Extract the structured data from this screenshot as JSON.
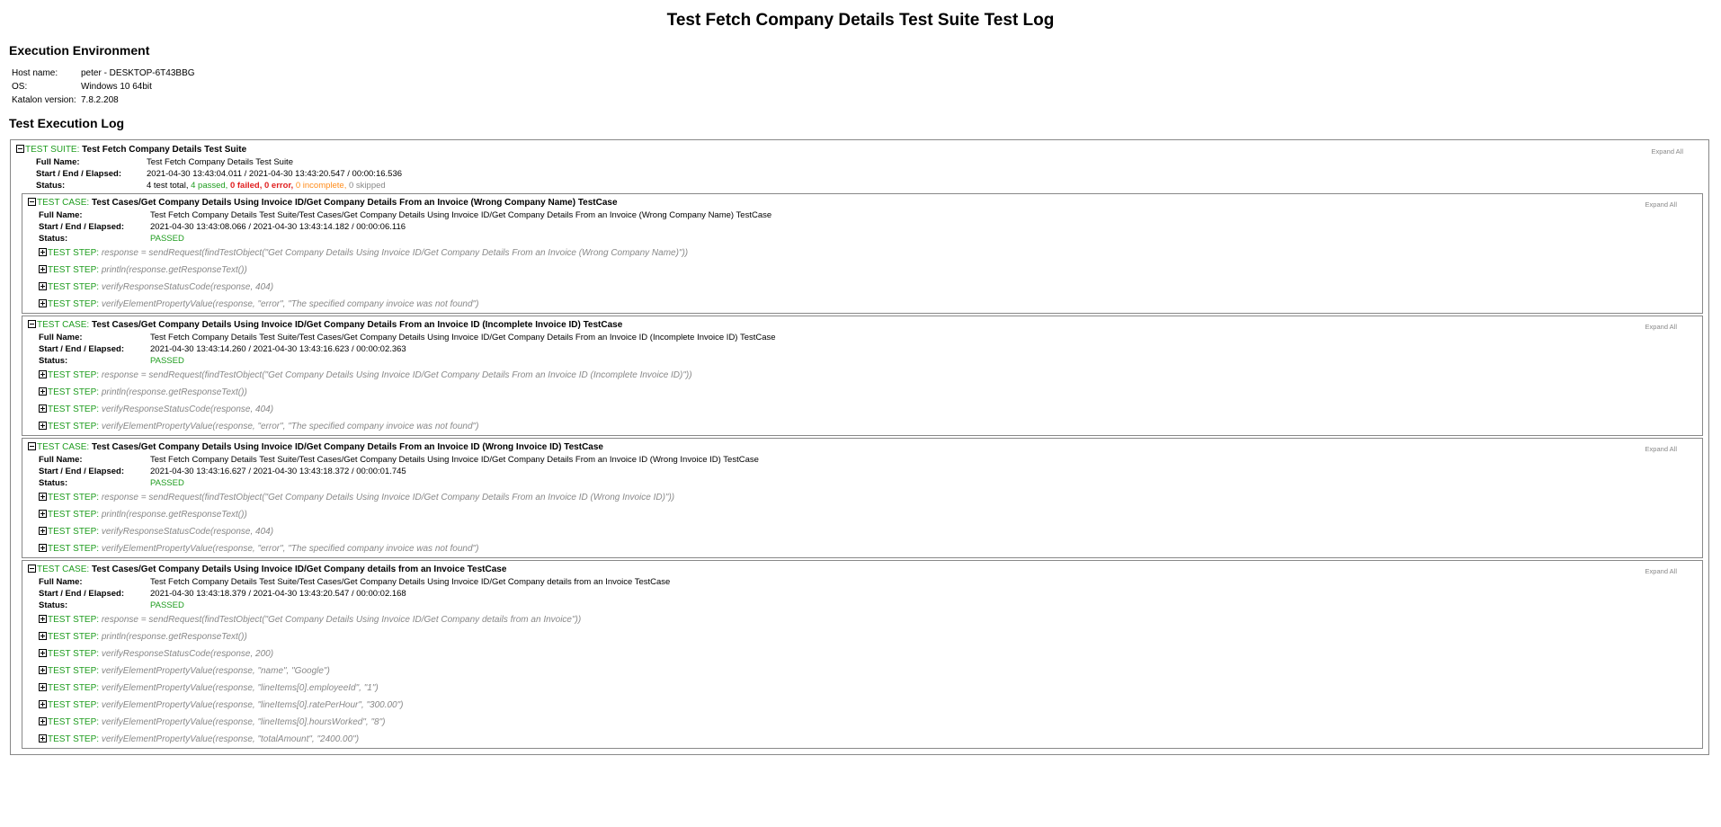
{
  "title": "Test Fetch Company Details Test Suite Test Log",
  "environment": {
    "heading": "Execution Environment",
    "rows": [
      {
        "label": "Host name:",
        "value": "peter - DESKTOP-6T43BBG"
      },
      {
        "label": "OS:",
        "value": "Windows 10 64bit"
      },
      {
        "label": "Katalon version:",
        "value": "7.8.2.208"
      }
    ]
  },
  "log_heading": "Test Execution Log",
  "labels": {
    "expand_all": "Expand All",
    "suite_kw": "TEST SUITE:",
    "case_kw": "TEST CASE:",
    "step_kw": "TEST STEP:",
    "full_name": "Full Name:",
    "start_end": "Start / End / Elapsed:",
    "status": "Status:"
  },
  "suite": {
    "name": "Test Fetch Company Details Test Suite",
    "full_name": "Test Fetch Company Details Test Suite",
    "timing": "2021-04-30 13:43:04.011 / 2021-04-30 13:43:20.547 / 00:00:16.536",
    "status": {
      "total": "4 test total,",
      "passed": "4 passed,",
      "failed": "0 failed,",
      "error": "0 error,",
      "incomplete": "0 incomplete,",
      "skipped": "0 skipped"
    }
  },
  "cases": [
    {
      "name": "Test Cases/Get Company Details Using Invoice ID/Get Company Details From an Invoice (Wrong Company Name) TestCase",
      "full_name": "Test Fetch Company Details Test Suite/Test Cases/Get Company Details Using Invoice ID/Get Company Details From an Invoice (Wrong Company Name) TestCase",
      "timing": "2021-04-30 13:43:08.066 / 2021-04-30 13:43:14.182 / 00:00:06.116",
      "status": "PASSED",
      "steps": [
        "response = sendRequest(findTestObject(\"Get Company Details Using Invoice ID/Get Company Details From an Invoice (Wrong Company Name)\"))",
        "println(response.getResponseText())",
        "verifyResponseStatusCode(response, 404)",
        "verifyElementPropertyValue(response, \"error\", \"The specified company invoice was not found\")"
      ]
    },
    {
      "name": "Test Cases/Get Company Details Using Invoice ID/Get Company Details From an Invoice ID (Incomplete Invoice ID) TestCase",
      "full_name": "Test Fetch Company Details Test Suite/Test Cases/Get Company Details Using Invoice ID/Get Company Details From an Invoice ID (Incomplete Invoice ID) TestCase",
      "timing": "2021-04-30 13:43:14.260 / 2021-04-30 13:43:16.623 / 00:00:02.363",
      "status": "PASSED",
      "steps": [
        "response = sendRequest(findTestObject(\"Get Company Details Using Invoice ID/Get Company Details From an Invoice ID (Incomplete Invoice ID)\"))",
        "println(response.getResponseText())",
        "verifyResponseStatusCode(response, 404)",
        "verifyElementPropertyValue(response, \"error\", \"The specified company invoice was not found\")"
      ]
    },
    {
      "name": "Test Cases/Get Company Details Using Invoice ID/Get Company Details From an Invoice ID (Wrong Invoice ID) TestCase",
      "full_name": "Test Fetch Company Details Test Suite/Test Cases/Get Company Details Using Invoice ID/Get Company Details From an Invoice ID (Wrong Invoice ID) TestCase",
      "timing": "2021-04-30 13:43:16.627 / 2021-04-30 13:43:18.372 / 00:00:01.745",
      "status": "PASSED",
      "steps": [
        "response = sendRequest(findTestObject(\"Get Company Details Using Invoice ID/Get Company Details From an Invoice ID (Wrong Invoice ID)\"))",
        "println(response.getResponseText())",
        "verifyResponseStatusCode(response, 404)",
        "verifyElementPropertyValue(response, \"error\", \"The specified company invoice was not found\")"
      ]
    },
    {
      "name": "Test Cases/Get Company Details Using Invoice ID/Get Company details from an Invoice TestCase",
      "full_name": "Test Fetch Company Details Test Suite/Test Cases/Get Company Details Using Invoice ID/Get Company details from an Invoice TestCase",
      "timing": "2021-04-30 13:43:18.379 / 2021-04-30 13:43:20.547 / 00:00:02.168",
      "status": "PASSED",
      "steps": [
        "response = sendRequest(findTestObject(\"Get Company Details Using Invoice ID/Get Company details from an Invoice\"))",
        "println(response.getResponseText())",
        "verifyResponseStatusCode(response, 200)",
        "verifyElementPropertyValue(response, \"name\", \"Google\")",
        "verifyElementPropertyValue(response, \"lineItems[0].employeeId\", \"1\")",
        "verifyElementPropertyValue(response, \"lineItems[0].ratePerHour\", \"300.00\")",
        "verifyElementPropertyValue(response, \"lineItems[0].hoursWorked\", \"8\")",
        "verifyElementPropertyValue(response, \"totalAmount\", \"2400.00\")"
      ]
    }
  ]
}
